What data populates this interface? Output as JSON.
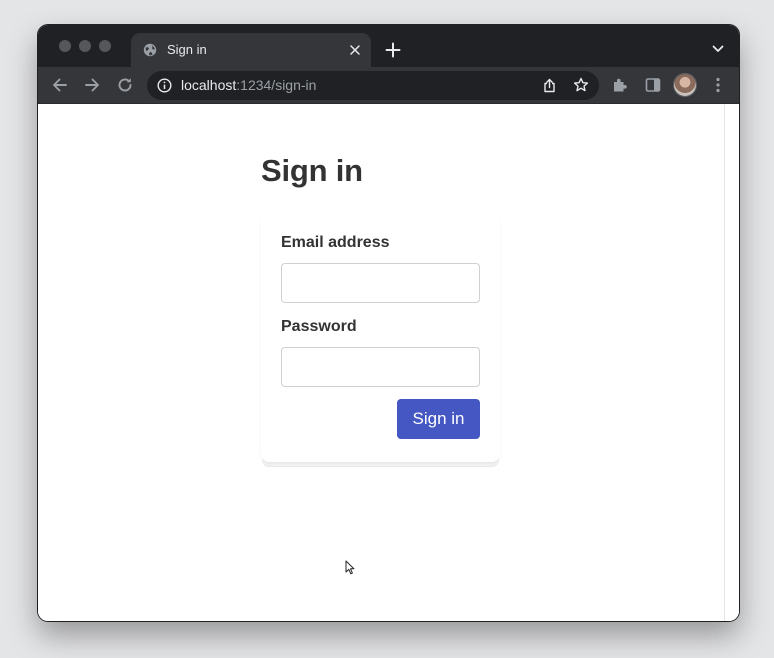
{
  "browser": {
    "tab": {
      "title": "Sign in",
      "favicon": "globe-icon",
      "close_icon": "close-icon"
    },
    "new_tab_icon": "plus-icon",
    "tab_search_icon": "chevron-down-icon",
    "toolbar": {
      "back_icon": "arrow-left-icon",
      "forward_icon": "arrow-right-icon",
      "reload_icon": "reload-icon",
      "extensions_icon": "puzzle-icon",
      "side_panel_icon": "side-panel-icon",
      "menu_icon": "kebab-menu-icon"
    },
    "omnibox": {
      "info_icon": "info-icon",
      "host": "localhost",
      "path": ":1234/sign-in",
      "share_icon": "share-icon",
      "bookmark_icon": "star-icon"
    }
  },
  "page": {
    "title": "Sign in",
    "form": {
      "email_label": "Email address",
      "email_value": "",
      "password_label": "Password",
      "password_value": "",
      "submit_label": "Sign in"
    }
  },
  "colors": {
    "accent": "#4557c2",
    "text": "#333333",
    "chrome_dark": "#202124",
    "chrome_toolbar": "#35363a"
  }
}
